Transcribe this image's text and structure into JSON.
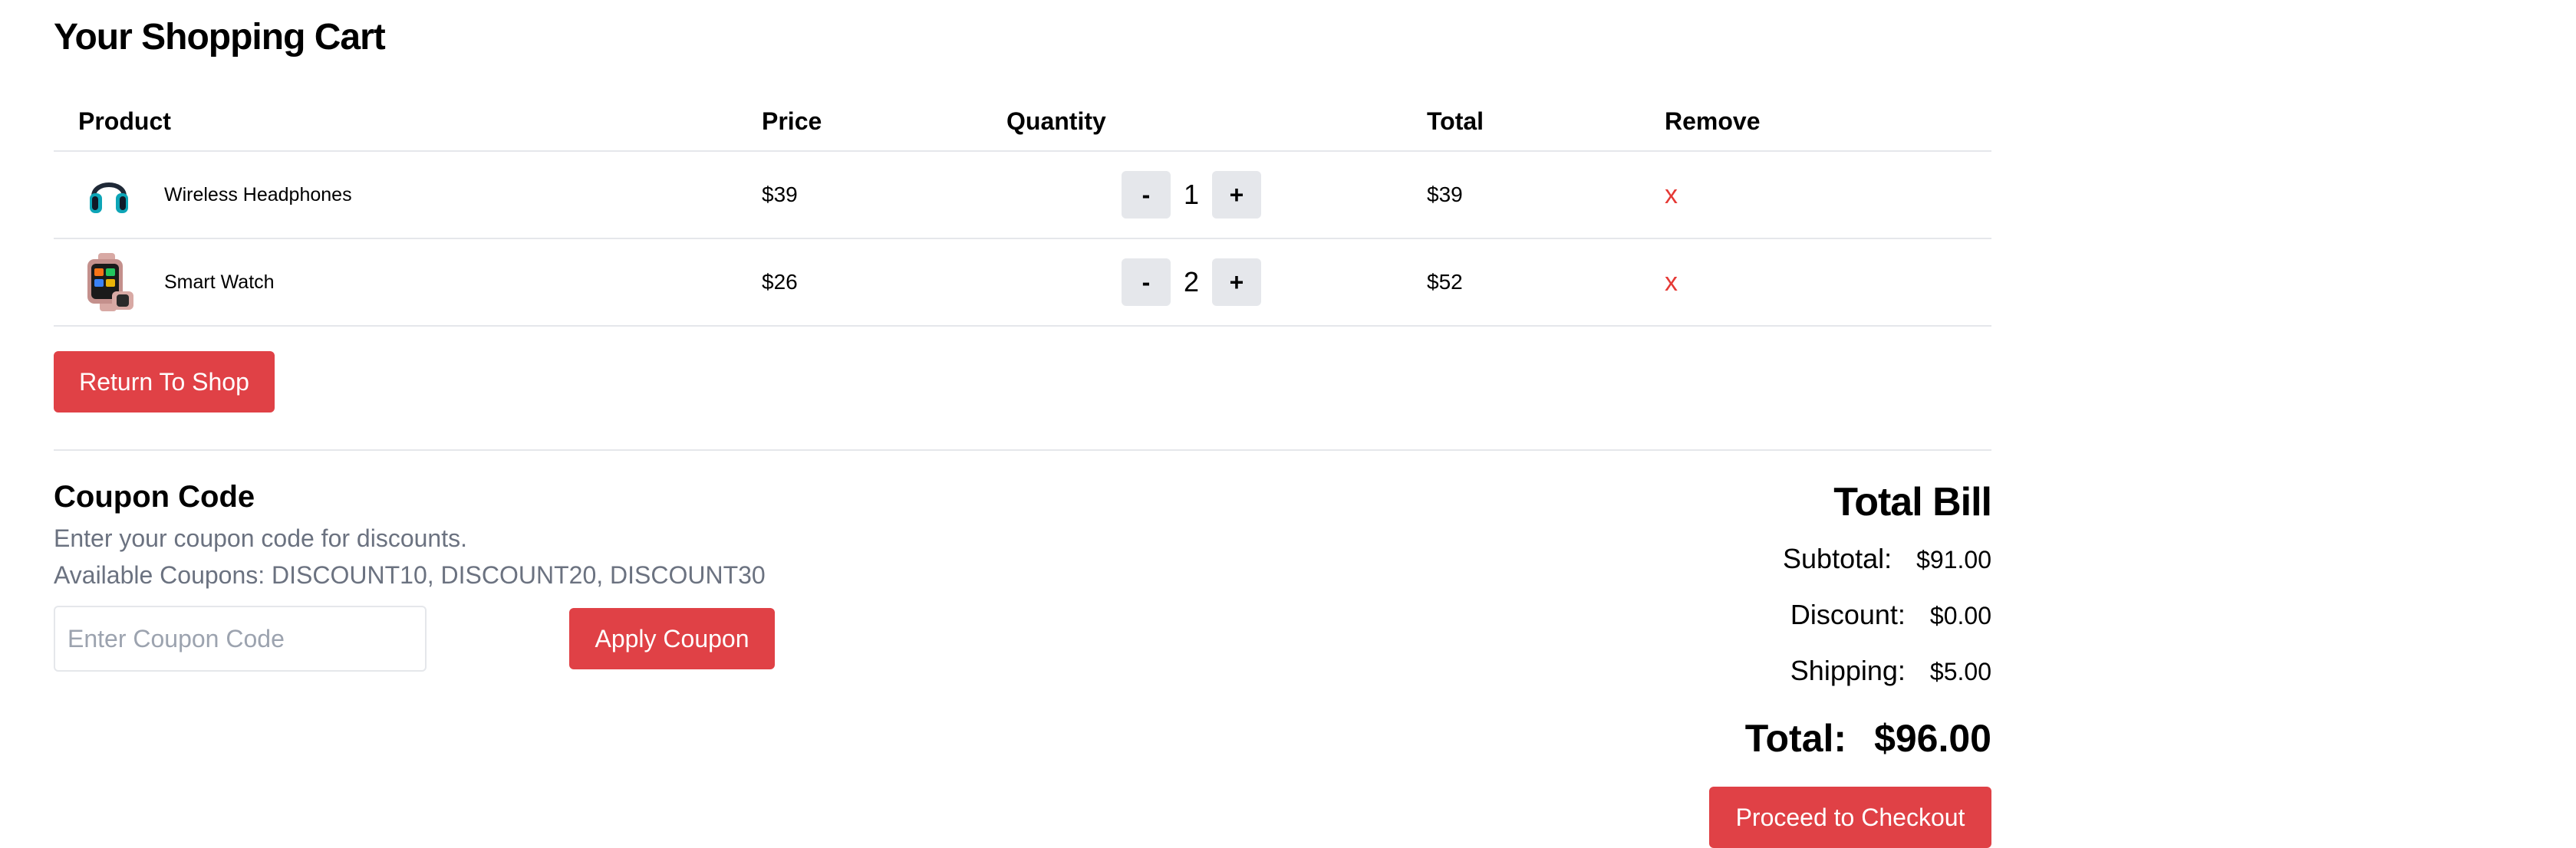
{
  "page": {
    "title": "Your Shopping Cart"
  },
  "colors": {
    "accent": "#e04146",
    "remove": "#e53935",
    "muted_text": "#6b7280",
    "border": "#e5e7eb",
    "qty_button_bg": "#e5e7eb"
  },
  "cart": {
    "columns": [
      "Product",
      "Price",
      "Quantity",
      "Total",
      "Remove"
    ],
    "items": [
      {
        "name": "Wireless Headphones",
        "icon": "headphones-icon",
        "price": "$39",
        "qty_minus": "-",
        "quantity": "1",
        "qty_plus": "+",
        "total": "$39",
        "remove": "x"
      },
      {
        "name": "Smart Watch",
        "icon": "smartwatch-icon",
        "price": "$26",
        "qty_minus": "-",
        "quantity": "2",
        "qty_plus": "+",
        "total": "$52",
        "remove": "x"
      }
    ],
    "return_button": "Return To Shop"
  },
  "coupon": {
    "title": "Coupon Code",
    "description": "Enter your coupon code for discounts.",
    "available": "Available Coupons: DISCOUNT10, DISCOUNT20, DISCOUNT30",
    "input_value": "",
    "input_placeholder": "Enter Coupon Code",
    "apply_button": "Apply Coupon"
  },
  "bill": {
    "title": "Total Bill",
    "subtotal_label": "Subtotal:",
    "subtotal_value": "$91.00",
    "discount_label": "Discount:",
    "discount_value": "$0.00",
    "shipping_label": "Shipping:",
    "shipping_value": "$5.00",
    "total_label": "Total:",
    "total_value": "$96.00",
    "checkout_button": "Proceed to Checkout"
  }
}
